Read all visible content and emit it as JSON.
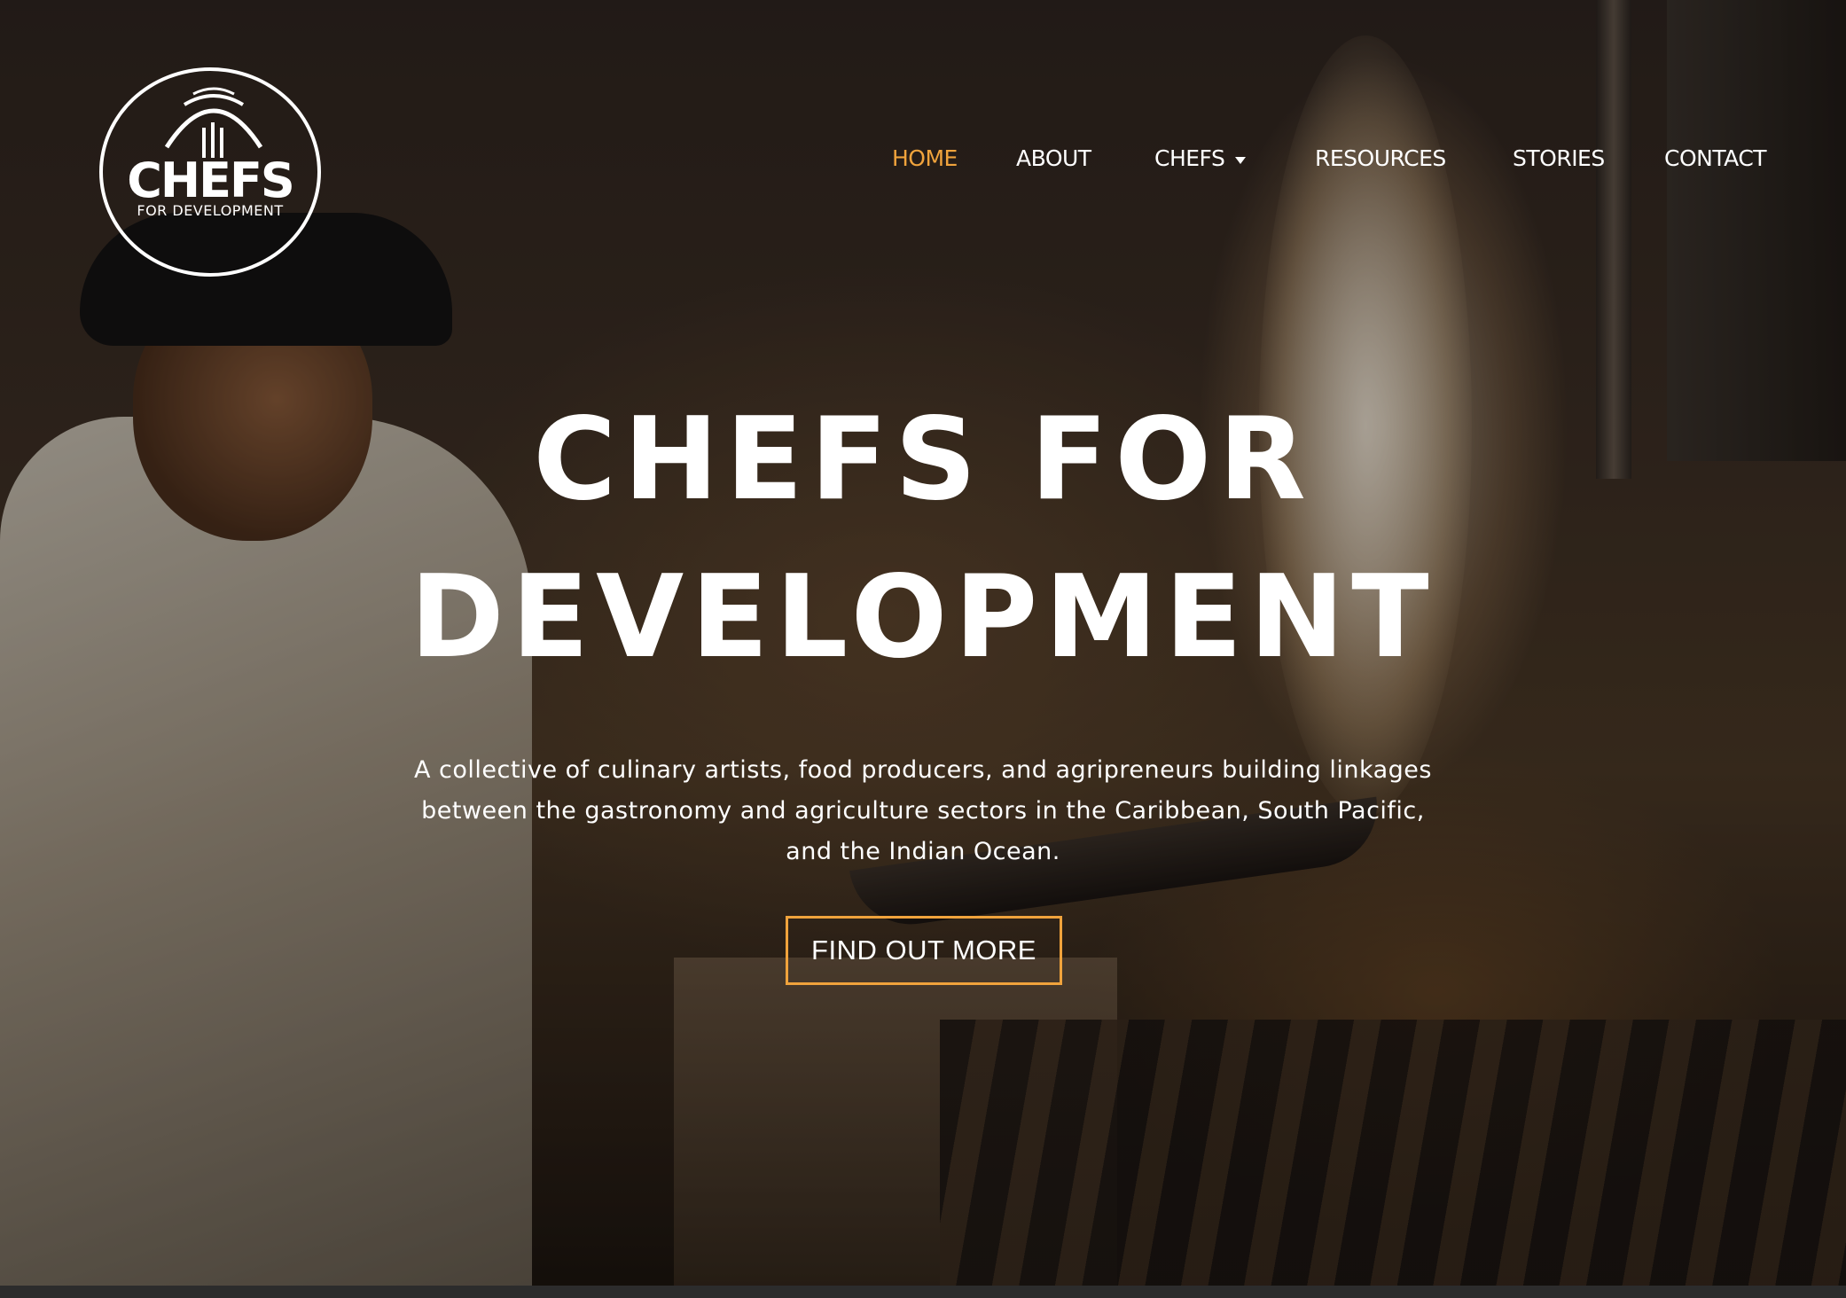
{
  "logo": {
    "title": "CHEFS",
    "subtitle": "FOR DEVELOPMENT",
    "icon": "cloche-fork-icon"
  },
  "nav": {
    "items": [
      {
        "label": "HOME",
        "active": true
      },
      {
        "label": "ABOUT",
        "active": false
      },
      {
        "label": "CHEFS",
        "active": false,
        "has_dropdown": true
      },
      {
        "label": "RESOURCES",
        "active": false
      },
      {
        "label": "STORIES",
        "active": false
      },
      {
        "label": "CONTACT",
        "active": false
      }
    ]
  },
  "hero": {
    "title_line1": "CHEFS FOR",
    "title_line2": "DEVELOPMENT",
    "subtitle_line1": "A collective of culinary artists, food producers, and agripreneurs building linkages",
    "subtitle_line2": "between the gastronomy and agriculture sectors in the Caribbean, South Pacific,",
    "subtitle_line3": "and the Indian Ocean.",
    "cta_label": "FIND OUT MORE"
  },
  "colors": {
    "accent": "#f0a33c",
    "text": "#ffffff"
  }
}
